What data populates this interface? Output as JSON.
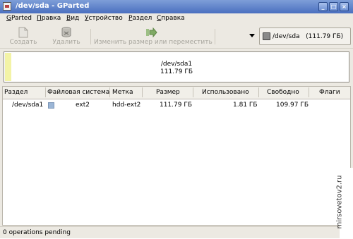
{
  "window": {
    "title": "/dev/sda - GParted"
  },
  "menu": [
    {
      "label_u": "G",
      "label_rest": "Parted"
    },
    {
      "label_u": "П",
      "label_rest": "равка"
    },
    {
      "label_u": "В",
      "label_rest": "ид"
    },
    {
      "label_u": "У",
      "label_rest": "стройство"
    },
    {
      "label_u": "Р",
      "label_rest": "аздел"
    },
    {
      "label_u": "С",
      "label_rest": "правка"
    }
  ],
  "toolbar": {
    "create_label": "Создать",
    "delete_label": "Удалить",
    "resize_label": "Изменить размер или переместить"
  },
  "device": {
    "name": "/dev/sda",
    "size": "(111.79 ГБ)"
  },
  "visual": {
    "partition": "/dev/sda1",
    "size": "111.79 ГБ"
  },
  "table": {
    "headers": [
      "Раздел",
      "Файловая система",
      "Метка",
      "Размер",
      "Использовано",
      "Свободно",
      "Флаги"
    ],
    "rows": [
      {
        "partition": "/dev/sda1",
        "filesystem": "ext2",
        "label": "hdd-ext2",
        "size": "111.79 ГБ",
        "used": "1.81 ГБ",
        "free": "109.97 ГБ",
        "flags": ""
      }
    ]
  },
  "status": "0 operations pending",
  "watermark": "mirsovetov2.ru",
  "colors": {
    "titlebar": "#4a6fbf",
    "ext2": "#9bb6d6",
    "used": "#f3f3a6"
  }
}
